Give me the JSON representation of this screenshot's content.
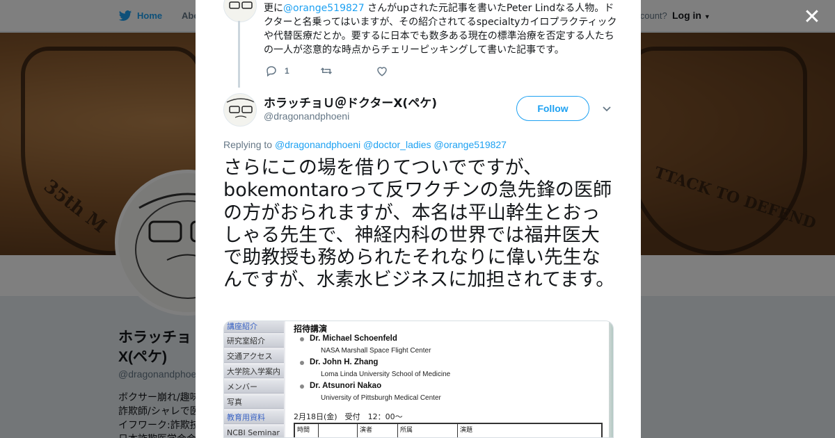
{
  "nav": {
    "home_label": "Home",
    "about_label": "Abo",
    "account_prompt": "account?",
    "login_label": "Log in"
  },
  "profile": {
    "name_line1": "ホラッチョ",
    "name_line2": "X(ペケ)",
    "handle": "@dragonandphoeni",
    "bio_lines": [
      "ボクサー崩れ/趣味",
      "詐欺師/シャレで医",
      "イフワーク:詐欺技",
      "日本詐欺医学会会"
    ]
  },
  "banner": {
    "text_left": "35th M",
    "text_right": "TTACK TO DEFEND"
  },
  "close_label": "✕",
  "previous_tweet": {
    "text_before": "更に",
    "mention": "@orange519827",
    "text_after": " さんがupされた元記事を書いたPeter Lindなる人物。ドクターと名乗ってはいますが、その紹介されてるspecialtyカイロプラクティックや代替医療だとか。要するに日本でも数多ある現在の標準治療を否定する人たちの一人が恣意的な時点からチェリーピッキングして書いた記事です。",
    "reply_count": "1"
  },
  "tweet": {
    "author_name": "ホラッチョＵ＠ドクターX(ペケ)",
    "author_handle": "@dragonandphoeni",
    "follow_label": "Follow",
    "replying_prefix": "Replying to",
    "replying_mentions": [
      "@dragonandphoeni",
      "@doctor_ladies",
      "@orange519827"
    ],
    "text": "さらにこの場を借りてついでですが、bokemontaroって反ワクチンの急先鋒の医師の方がおられますが、本名は平山幹生とおっしゃる先生で、神経内科の世界では福井医大で助教授も務められたそれなりに偉い先生なんですが、水素水ビジネスに加担されてます。"
  },
  "media": {
    "menu_items": [
      "講座紹介",
      "研究室紹介",
      "交通アクセス",
      "大学院入学案内",
      "メンバー",
      "写真",
      "教育用資料",
      "NCBI Seminar"
    ],
    "doc_title": "招待講演",
    "speakers": [
      {
        "name": "Dr. Michael Schoenfeld",
        "affiliation": "NASA Marshall Space Flight Center"
      },
      {
        "name": "Dr. John H. Zhang",
        "affiliation": "Loma Linda University School of Medicine"
      },
      {
        "name": "Dr. Atsunori Nakao",
        "affiliation": "University of Pittsburgh Medical Center"
      }
    ],
    "date_line": "2月18日(金)　受付　12：00～",
    "table_headers": [
      "時間",
      "",
      "演者",
      "所属",
      "演題"
    ]
  },
  "colors": {
    "accent": "#1da1f2",
    "text": "#14171a",
    "secondary": "#657786"
  }
}
